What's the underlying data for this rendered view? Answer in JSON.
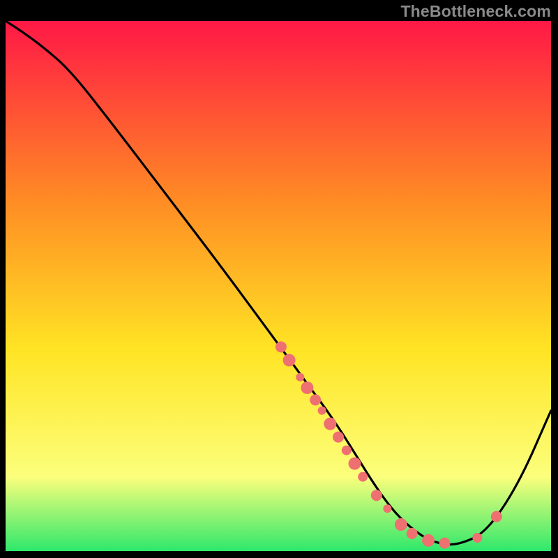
{
  "watermark": "TheBottleneck.com",
  "colors": {
    "gradient_top": "#ff1846",
    "gradient_mid1": "#ff8c24",
    "gradient_mid2": "#ffe424",
    "gradient_mid3": "#fcff7c",
    "gradient_bottom": "#2ee86b",
    "curve": "#000000",
    "marker": "#ef7070",
    "bg": "#000000"
  },
  "chart_data": {
    "type": "line",
    "title": "",
    "xlabel": "",
    "ylabel": "",
    "xlim": [
      0,
      100
    ],
    "ylim": [
      0,
      100
    ],
    "curve": {
      "x": [
        0,
        3,
        7,
        12,
        20,
        30,
        40,
        50,
        55,
        60,
        64,
        67,
        70,
        73,
        77,
        80,
        83,
        88,
        94,
        100
      ],
      "y": [
        100,
        98,
        95,
        90.5,
        80,
        66.5,
        53,
        39,
        32,
        25,
        18.5,
        13.5,
        9,
        5.5,
        2.3,
        1.3,
        1.2,
        3.4,
        12.5,
        26.5
      ]
    },
    "markers": [
      {
        "x": 50.5,
        "y": 38.5,
        "r": 8
      },
      {
        "x": 52.0,
        "y": 36.0,
        "r": 9
      },
      {
        "x": 54.0,
        "y": 32.8,
        "r": 6
      },
      {
        "x": 55.3,
        "y": 30.8,
        "r": 9
      },
      {
        "x": 56.8,
        "y": 28.5,
        "r": 8
      },
      {
        "x": 58.0,
        "y": 26.5,
        "r": 6
      },
      {
        "x": 59.5,
        "y": 24.0,
        "r": 9
      },
      {
        "x": 61.0,
        "y": 21.5,
        "r": 8
      },
      {
        "x": 62.5,
        "y": 19.0,
        "r": 7
      },
      {
        "x": 64.0,
        "y": 16.5,
        "r": 9
      },
      {
        "x": 65.5,
        "y": 14.0,
        "r": 7
      },
      {
        "x": 68.0,
        "y": 10.5,
        "r": 8
      },
      {
        "x": 70.0,
        "y": 8.0,
        "r": 6
      },
      {
        "x": 72.5,
        "y": 5.0,
        "r": 9
      },
      {
        "x": 74.5,
        "y": 3.3,
        "r": 8
      },
      {
        "x": 77.5,
        "y": 2.0,
        "r": 9
      },
      {
        "x": 80.5,
        "y": 1.5,
        "r": 8
      },
      {
        "x": 86.5,
        "y": 2.5,
        "r": 7
      },
      {
        "x": 90.0,
        "y": 6.5,
        "r": 8
      }
    ]
  }
}
